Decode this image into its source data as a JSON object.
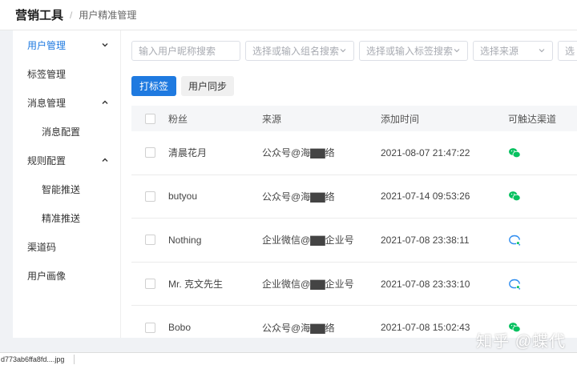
{
  "header": {
    "title": "营销工具",
    "separator": "/",
    "breadcrumb": "用户精准管理"
  },
  "sidebar": {
    "items": [
      {
        "label": "用户管理",
        "active": true,
        "expand": "down"
      },
      {
        "label": "标签管理"
      },
      {
        "label": "消息管理",
        "expand": "up"
      },
      {
        "label": "消息配置",
        "sub": true
      },
      {
        "label": "规则配置",
        "expand": "up"
      },
      {
        "label": "智能推送",
        "sub": true
      },
      {
        "label": "精准推送",
        "sub": true
      },
      {
        "label": "渠道码"
      },
      {
        "label": "用户画像"
      }
    ]
  },
  "filters": {
    "nickname_placeholder": "输入用户昵称搜索",
    "group_placeholder": "选择或输入组名搜索",
    "tag_placeholder": "选择或输入标签搜索",
    "source_placeholder": "选择来源",
    "extra_placeholder": "选"
  },
  "actions": {
    "tag_button": "打标签",
    "sync_button": "用户同步"
  },
  "table": {
    "headers": {
      "fans": "粉丝",
      "source": "来源",
      "time": "添加时间",
      "channel": "可触达渠道"
    },
    "rows": [
      {
        "fans": "清晨花月",
        "source": "公众号@海▇▇络",
        "time": "2021-08-07 21:47:22",
        "channel": "wechat-icon"
      },
      {
        "fans": "butyou",
        "source": "公众号@海▇▇络",
        "time": "2021-07-14 09:53:26",
        "channel": "wechat-icon"
      },
      {
        "fans": "Nothing",
        "source": "企业微信@▇▇企业号",
        "time": "2021-07-08 23:38:11",
        "channel": "work-wechat-icon"
      },
      {
        "fans": "Mr. 克文先生",
        "source": "企业微信@▇▇企业号",
        "time": "2021-07-08 23:33:10",
        "channel": "work-wechat-icon"
      },
      {
        "fans": "Bobo",
        "source": "公众号@海▇▇络",
        "time": "2021-07-08 15:02:43",
        "channel": "wechat-icon"
      }
    ]
  },
  "colors": {
    "primary": "#1f7ae0",
    "wechat_green": "#07c160",
    "work_wechat_blue": "#2d8cf0"
  },
  "statusbar": {
    "filename": "d773ab6ffa8fd....jpg"
  },
  "watermark": "知乎 @蝶代"
}
